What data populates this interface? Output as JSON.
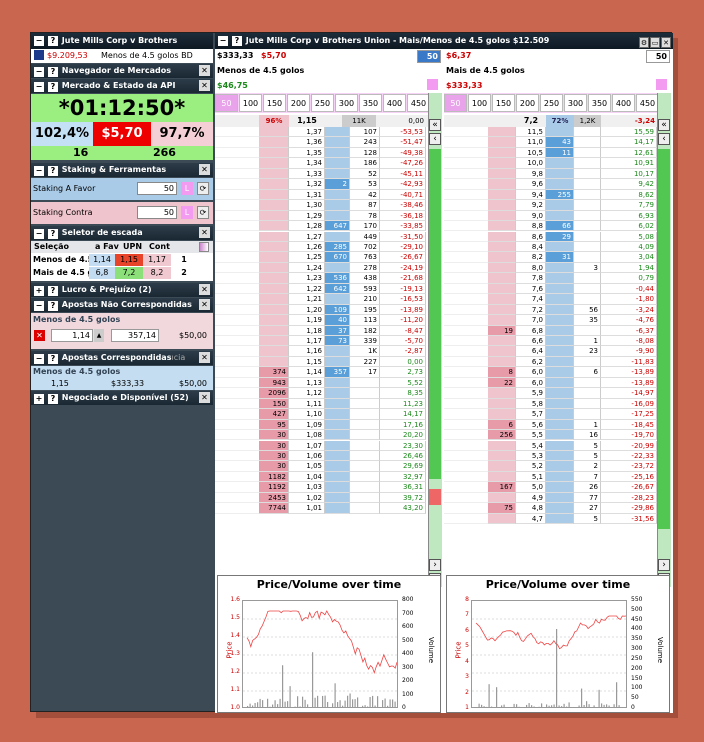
{
  "colors": {
    "back": "#a9cbe8",
    "lay": "#f0c4cc",
    "red": "#cc0000",
    "green": "#1a8a1a",
    "pink": "#f29bf0"
  },
  "left": {
    "title": "Jute Mills Corp v Brothers",
    "balance": "$9.209,53",
    "market": "Menos de 4.5 golos BD",
    "nav": "Navegador de Mercados",
    "api": "Mercado & Estado da API",
    "timer": "*01:12:50*",
    "pct_back": "102,4%",
    "price": "$5,70",
    "pct_lay": "97,7%",
    "count_left": "16",
    "count_right": "266",
    "staking": "Staking & Ferramentas",
    "stake_favor_label": "Staking A Favor",
    "stake_favor": "50",
    "stake_contra_label": "Staking Contra",
    "stake_contra": "50",
    "selector": "Seletor de escada",
    "sel_headers": [
      "Seleção",
      "a Fav",
      "UPN",
      "Cont"
    ],
    "sel_rows": [
      {
        "name": "Menos de 4.5 g",
        "fav": "1,14",
        "upn": "1,15",
        "cont": "1,17",
        "n": "1"
      },
      {
        "name": "Mais de 4.5 gol",
        "fav": "6,8",
        "upn": "7,2",
        "cont": "8,2",
        "n": "2"
      }
    ],
    "profit": "Lucro & Prejuízo (2)",
    "unmatched": "Apostas Não Correspondidas",
    "unmatched_sel": "Menos de 4.5 golos",
    "unmatched_odds": "1,14",
    "unmatched_val": "357,14",
    "unmatched_stake": "$50,00",
    "matched": "Apostas Correspondidas",
    "matched_suffix": "ıcia",
    "matched_sel": "Menos de 4.5 golos",
    "matched_odds": "1,15",
    "matched_val": "$333,33",
    "matched_stake": "$50,00",
    "traded": "Negociado e Disponível (52)"
  },
  "main_title": "Jute Mills Corp v Brothers Union - Mais/Menos de 4.5 golos  $12.509",
  "l1": {
    "liab": "$333,33",
    "price": "$5,70",
    "stake": "50",
    "name": "Menos de 4.5 golos",
    "pl": "$46,75",
    "pl_color": "#1a8a1a",
    "top": {
      "pct": "96%",
      "ltp": "1,15",
      "vol": "11K",
      "pl": "0,00"
    }
  },
  "l2": {
    "liab": "$6,37",
    "stake": "50",
    "name": "Mais de 4.5 golos",
    "pl": "$333,33",
    "pl_color": "#cc0000",
    "top": {
      "ltp": "7,2",
      "pct": "72%",
      "vol": "1,2K",
      "pl": "-3,24"
    }
  },
  "stakes": [
    "50",
    "100",
    "150",
    "200",
    "250",
    "300",
    "350",
    "400",
    "450"
  ],
  "ladder1": [
    [
      "",
      "1,37",
      "",
      "107",
      "-53,53"
    ],
    [
      "",
      "1,36",
      "",
      "243",
      "-51,47"
    ],
    [
      "",
      "1,35",
      "",
      "128",
      "-49,38"
    ],
    [
      "",
      "1,34",
      "",
      "186",
      "-47,26"
    ],
    [
      "",
      "1,33",
      "",
      "52",
      "-45,11"
    ],
    [
      "",
      "1,32",
      "2",
      "53",
      "-42,93"
    ],
    [
      "",
      "1,31",
      "",
      "42",
      "-40,71"
    ],
    [
      "",
      "1,30",
      "",
      "87",
      "-38,46"
    ],
    [
      "",
      "1,29",
      "",
      "78",
      "-36,18"
    ],
    [
      "",
      "1,28",
      "647",
      "170",
      "-33,85"
    ],
    [
      "",
      "1,27",
      "",
      "449",
      "-31,50"
    ],
    [
      "",
      "1,26",
      "285",
      "702",
      "-29,10"
    ],
    [
      "",
      "1,25",
      "670",
      "763",
      "-26,67"
    ],
    [
      "",
      "1,24",
      "",
      "278",
      "-24,19"
    ],
    [
      "",
      "1,23",
      "536",
      "438",
      "-21,68"
    ],
    [
      "",
      "1,22",
      "642",
      "593",
      "-19,13"
    ],
    [
      "",
      "1,21",
      "",
      "210",
      "-16,53"
    ],
    [
      "",
      "1,20",
      "109",
      "195",
      "-13,89"
    ],
    [
      "",
      "1,19",
      "40",
      "113",
      "-11,20"
    ],
    [
      "",
      "1,18",
      "37",
      "182",
      "-8,47"
    ],
    [
      "",
      "1,17",
      "73",
      "339",
      "-5,70"
    ],
    [
      "",
      "1,16",
      "",
      "1K",
      "-2,87"
    ],
    [
      "",
      "1,15",
      "",
      "227",
      "0,00"
    ],
    [
      "374",
      "1,14",
      "357",
      "17",
      "2,73"
    ],
    [
      "943",
      "1,13",
      "",
      "",
      "5,52"
    ],
    [
      "2096",
      "1,12",
      "",
      "",
      "8,35"
    ],
    [
      "150",
      "1,11",
      "",
      "",
      "11,23"
    ],
    [
      "427",
      "1,10",
      "",
      "",
      "14,17"
    ],
    [
      "95",
      "1,09",
      "",
      "",
      "17,16"
    ],
    [
      "30",
      "1,08",
      "",
      "",
      "20,20"
    ],
    [
      "30",
      "1,07",
      "",
      "",
      "23,30"
    ],
    [
      "30",
      "1,06",
      "",
      "",
      "26,46"
    ],
    [
      "30",
      "1,05",
      "",
      "",
      "29,69"
    ],
    [
      "1182",
      "1,04",
      "",
      "",
      "32,97"
    ],
    [
      "1192",
      "1,03",
      "",
      "",
      "36,31"
    ],
    [
      "2453",
      "1,02",
      "",
      "",
      "39,72"
    ],
    [
      "7744",
      "1,01",
      "",
      "",
      "43,20"
    ]
  ],
  "ladder2": [
    [
      "",
      "11,5",
      "",
      "",
      "15,59"
    ],
    [
      "",
      "11,0",
      "43",
      "",
      "14,17"
    ],
    [
      "",
      "10,5",
      "11",
      "",
      "12,61"
    ],
    [
      "",
      "10,0",
      "",
      "",
      "10,91"
    ],
    [
      "",
      "9,8",
      "",
      "",
      "10,17"
    ],
    [
      "",
      "9,6",
      "",
      "",
      "9,42"
    ],
    [
      "",
      "9,4",
      "255",
      "",
      "8,62"
    ],
    [
      "",
      "9,2",
      "",
      "",
      "7,79"
    ],
    [
      "",
      "9,0",
      "",
      "",
      "6,93"
    ],
    [
      "",
      "8,8",
      "66",
      "",
      "6,02"
    ],
    [
      "",
      "8,6",
      "29",
      "",
      "5,08"
    ],
    [
      "",
      "8,4",
      "",
      "",
      "4,09"
    ],
    [
      "",
      "8,2",
      "31",
      "",
      "3,04"
    ],
    [
      "",
      "8,0",
      "",
      "3",
      "1,94"
    ],
    [
      "",
      "7,8",
      "",
      "",
      "0,79"
    ],
    [
      "",
      "7,6",
      "",
      "",
      "-0,44"
    ],
    [
      "",
      "7,4",
      "",
      "",
      "-1,80"
    ],
    [
      "",
      "7,2",
      "",
      "56",
      "-3,24"
    ],
    [
      "",
      "7,0",
      "",
      "35",
      "-4,76"
    ],
    [
      "19",
      "6,8",
      "",
      "",
      "-6,37"
    ],
    [
      "",
      "6,6",
      "",
      "1",
      "-8,08"
    ],
    [
      "",
      "6,4",
      "",
      "23",
      "-9,90"
    ],
    [
      "",
      "6,2",
      "",
      "",
      "-11,83"
    ],
    [
      "8",
      "6,0",
      "",
      "6",
      "-13,89"
    ],
    [
      "22",
      "6,0",
      "",
      "",
      "-13,89"
    ],
    [
      "",
      "5,9",
      "",
      "",
      "-14,97"
    ],
    [
      "",
      "5,8",
      "",
      "",
      "-16,09"
    ],
    [
      "",
      "5,7",
      "",
      "",
      "-17,25"
    ],
    [
      "6",
      "5,6",
      "",
      "1",
      "-18,45"
    ],
    [
      "256",
      "5,5",
      "",
      "16",
      "-19,70"
    ],
    [
      "",
      "5,4",
      "",
      "5",
      "-20,99"
    ],
    [
      "",
      "5,3",
      "",
      "5",
      "-22,33"
    ],
    [
      "",
      "5,2",
      "",
      "2",
      "-23,72"
    ],
    [
      "",
      "5,1",
      "",
      "7",
      "-25,16"
    ],
    [
      "167",
      "5,0",
      "",
      "26",
      "-26,67"
    ],
    [
      "",
      "4,9",
      "",
      "77",
      "-28,23"
    ],
    [
      "75",
      "4,8",
      "",
      "27",
      "-29,86"
    ],
    [
      "",
      "4,7",
      "",
      "5",
      "-31,56"
    ]
  ],
  "charts": [
    {
      "title": "Price/Volume over time",
      "ylabel": "Price",
      "ylabel2": "Volume",
      "yticks": [
        "1.6",
        "1.5",
        "1.4",
        "1.3",
        "1.2",
        "1.1",
        "1.0"
      ],
      "y2ticks": [
        "800",
        "700",
        "600",
        "500",
        "400",
        "300",
        "200",
        "100",
        "0"
      ]
    },
    {
      "title": "Price/Volume over time",
      "ylabel": "Price",
      "ylabel2": "Volume",
      "yticks": [
        "8",
        "7",
        "6",
        "5",
        "4",
        "3",
        "2",
        "1"
      ],
      "y2ticks": [
        "550",
        "500",
        "450",
        "400",
        "350",
        "300",
        "250",
        "200",
        "150",
        "100",
        "50",
        "0"
      ]
    }
  ]
}
